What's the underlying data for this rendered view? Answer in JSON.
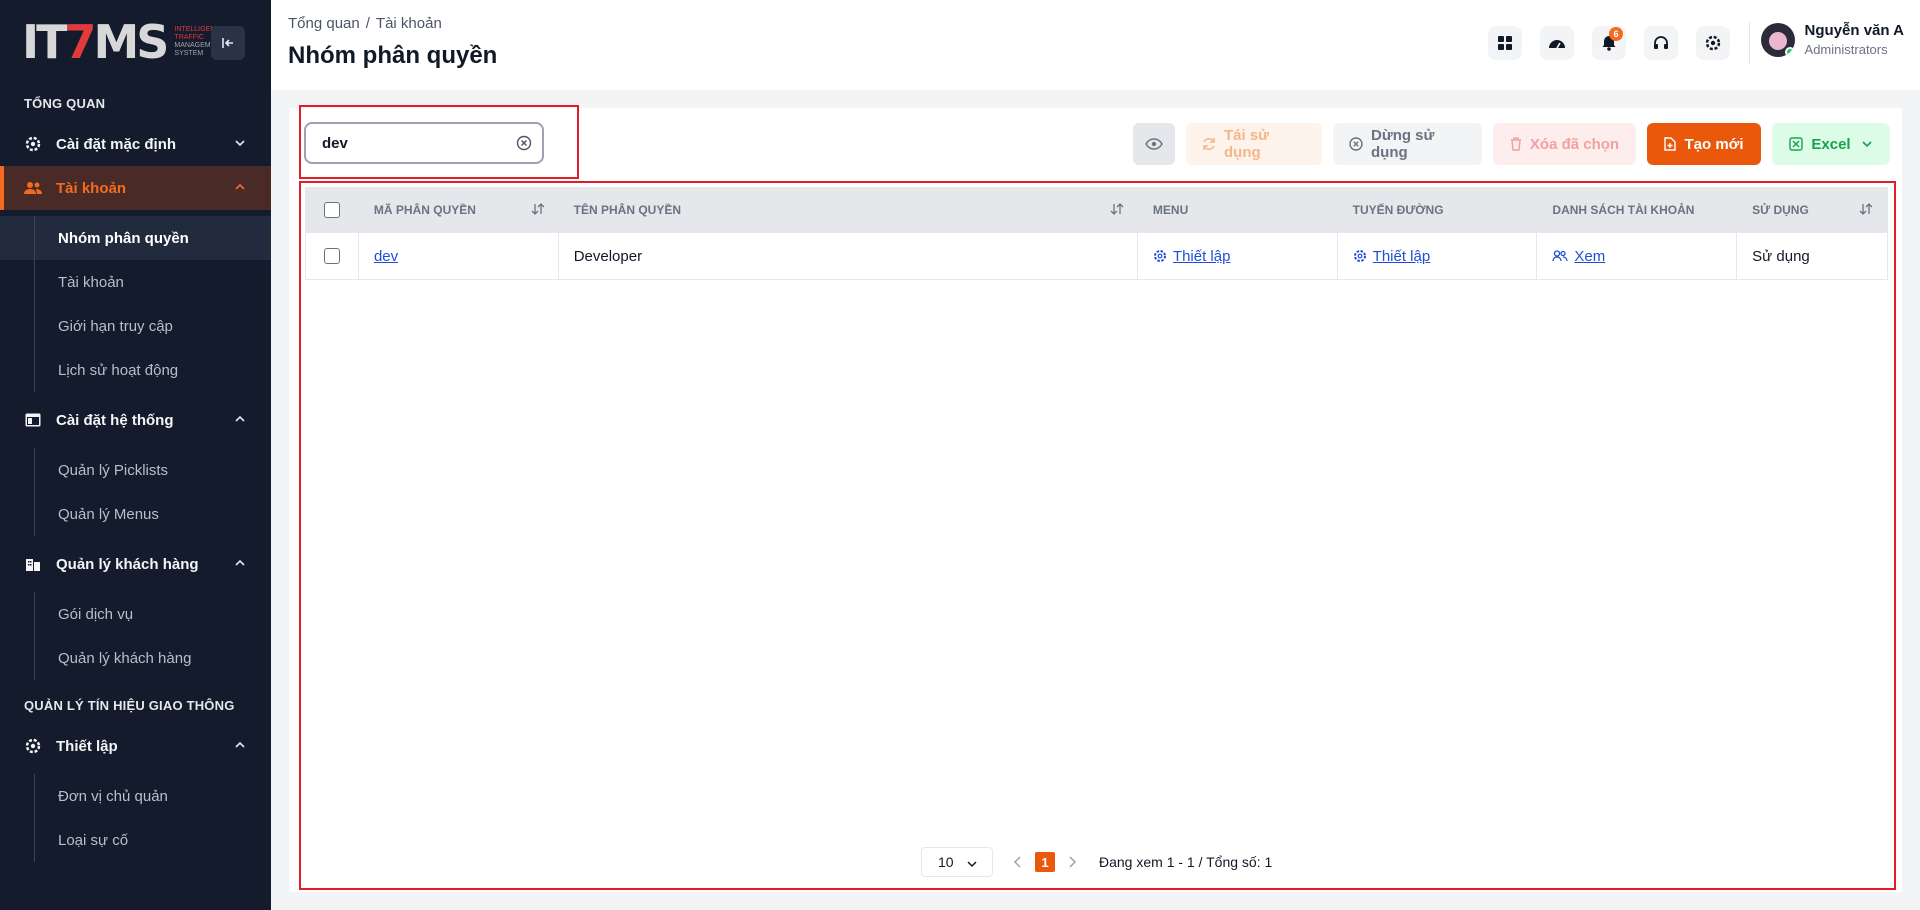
{
  "sidebar": {
    "logo": {
      "mark_a": "IT",
      "mark_b": "MS",
      "line1": "INTELLIGENT",
      "line2": "TRAFFIC",
      "line3": "MANAGEMENT",
      "line4": "SYSTEM"
    },
    "section_overview": "TỔNG QUAN",
    "items": {
      "default_settings": "Cài đặt mặc định",
      "account": "Tài khoản",
      "system_settings": "Cài đặt hệ thống",
      "customer_mgmt": "Quản lý khách hàng",
      "setup": "Thiết lập"
    },
    "account_sub": [
      "Nhóm phân quyền",
      "Tài khoản",
      "Giới hạn truy cập",
      "Lịch sử hoạt động"
    ],
    "system_sub": [
      "Quản lý Picklists",
      "Quản lý Menus"
    ],
    "customer_sub": [
      "Gói dịch vụ",
      "Quản lý khách hàng"
    ],
    "section_signals": "QUẢN LÝ TÍN HIỆU GIAO THÔNG",
    "setup_sub": [
      "Đơn vị chủ quản",
      "Loại sự cố"
    ]
  },
  "header": {
    "breadcrumb": [
      "Tổng quan",
      "Tài khoản"
    ],
    "breadcrumb_sep": "/",
    "title": "Nhóm phân quyền",
    "notification_count": "6",
    "user": {
      "name": "Nguyễn văn A",
      "role": "Administrators"
    }
  },
  "search": {
    "value": "dev"
  },
  "toolbar": {
    "reuse": "Tái sử dụng",
    "stop": "Dừng sử dụng",
    "delete": "Xóa đã chọn",
    "create": "Tạo mới",
    "excel": "Excel"
  },
  "table": {
    "columns": [
      "MÃ PHÂN QUYỀN",
      "TÊN PHÂN QUYỀN",
      "MENU",
      "TUYẾN ĐƯỜNG",
      "DANH SÁCH TÀI KHOẢN",
      "SỬ DỤNG"
    ],
    "rows": [
      {
        "code": "dev",
        "name": "Developer",
        "menu": "Thiết lập",
        "route": "Thiết lập",
        "accounts": "Xem",
        "status": "Sử dụng"
      }
    ]
  },
  "pagination": {
    "page_size": "10",
    "current_page": "1",
    "info": "Đang xem 1 - 1 / Tổng số: 1"
  },
  "colors": {
    "accent": "#ea580c",
    "sidebar_bg": "#131b2c",
    "highlight_border": "#e11d2a",
    "link": "#1d4ed8"
  }
}
